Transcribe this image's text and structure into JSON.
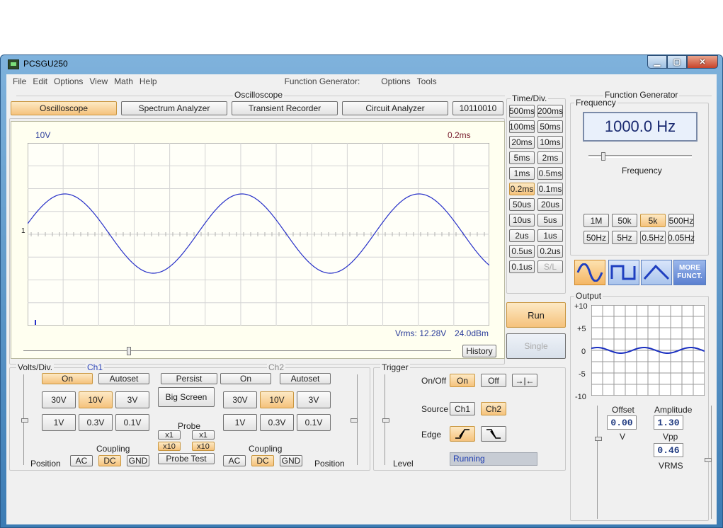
{
  "window": {
    "title": "PCSGU250"
  },
  "menu": {
    "file": "File",
    "edit": "Edit",
    "options": "Options",
    "view": "View",
    "math": "Math",
    "help": "Help",
    "fg": "Function Generator:",
    "fg_options": "Options",
    "fg_tools": "Tools"
  },
  "osc_section": "Oscilloscope",
  "fg_section": "Function Generator",
  "modes": {
    "oscilloscope": "Oscilloscope",
    "spectrum": "Spectrum Analyzer",
    "transient": "Transient Recorder",
    "circuit": "Circuit Analyzer",
    "code": "10110010"
  },
  "scope": {
    "volts_label": "10V",
    "time_label": "0.2ms",
    "marker": "1",
    "vrms": "Vrms: 12.28V",
    "dbm": "24.0dBm",
    "history": "History"
  },
  "timediv": {
    "title": "Time/Div.",
    "buttons": [
      "500ms",
      "200ms",
      "100ms",
      "50ms",
      "20ms",
      "10ms",
      "5ms",
      "2ms",
      "1ms",
      "0.5ms",
      "0.2ms",
      "0.1ms",
      "50us",
      "20us",
      "10us",
      "5us",
      "2us",
      "1us",
      "0.5us",
      "0.2us",
      "0.1us",
      "S/L"
    ],
    "selected": "0.2ms",
    "disabled": "S/L"
  },
  "run": {
    "run": "Run",
    "single": "Single"
  },
  "frequency": {
    "group": "Frequency",
    "value": "1000.0 Hz",
    "slider_label": "Frequency",
    "range_buttons": [
      "1M",
      "50k",
      "5k",
      "500Hz",
      "50Hz",
      "5Hz",
      "0.5Hz",
      "0.05Hz"
    ],
    "selected": "5k"
  },
  "waveforms": {
    "more": "MORE FUNCT.",
    "selected": "sine"
  },
  "output": {
    "group": "Output",
    "yticks": [
      "+10",
      "+5",
      "0",
      "-5",
      "-10"
    ],
    "offset_label": "Offset",
    "offset_value": "0.00",
    "offset_unit": "V",
    "amplitude_label": "Amplitude",
    "amplitude_value": "1.30",
    "vpp_label": "Vpp",
    "vrms_value": "0.46",
    "vrms_label": "VRMS"
  },
  "volts": {
    "group": "Volts/Div.",
    "ch1": "Ch1",
    "ch2": "Ch2",
    "on": "On",
    "autoset": "Autoset",
    "persist": "Persist",
    "bigscreen": "Big Screen",
    "ranges": [
      "30V",
      "10V",
      "3V",
      "1V",
      "0.3V",
      "0.1V"
    ],
    "selected": "10V",
    "probe": "Probe",
    "x1": "x1",
    "x10": "x10",
    "probe_test": "Probe Test",
    "coupling": "Coupling",
    "ac": "AC",
    "dc": "DC",
    "gnd": "GND",
    "position": "Position"
  },
  "trigger": {
    "group": "Trigger",
    "onoff": "On/Off",
    "on": "On",
    "off": "Off",
    "source": "Source",
    "ch1": "Ch1",
    "ch2": "Ch2",
    "edge": "Edge",
    "level": "Level",
    "status": "Running"
  }
}
